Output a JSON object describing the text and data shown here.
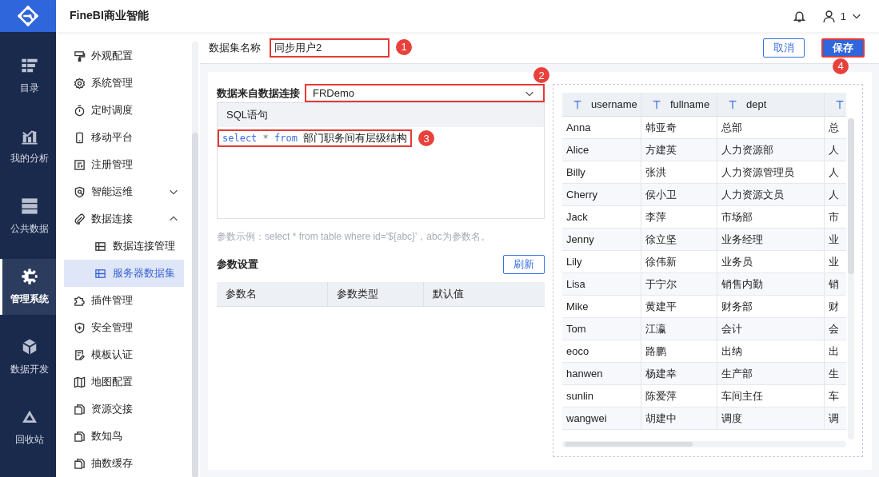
{
  "app": {
    "title": "FineBI商业智能",
    "user": "1"
  },
  "rail": [
    {
      "label": "目录",
      "kind": "catalog",
      "selected": false
    },
    {
      "label": "我的分析",
      "kind": "analysis",
      "selected": false
    },
    {
      "label": "公共数据",
      "kind": "public",
      "selected": false
    },
    {
      "label": "管理系统",
      "kind": "system",
      "selected": true
    },
    {
      "label": "数据开发",
      "kind": "dev",
      "selected": false
    },
    {
      "label": "回收站",
      "kind": "recycle",
      "selected": false
    }
  ],
  "menu": [
    {
      "label": "外观配置",
      "kind": "brush",
      "selected": false
    },
    {
      "label": "系统管理",
      "kind": "gear",
      "selected": false
    },
    {
      "label": "定时调度",
      "kind": "timer",
      "selected": false
    },
    {
      "label": "移动平台",
      "kind": "phone",
      "selected": false
    },
    {
      "label": "注册管理",
      "kind": "form",
      "selected": false
    },
    {
      "label": "智能运维",
      "kind": "shield",
      "selected": false,
      "expanded": false
    },
    {
      "label": "数据连接",
      "kind": "clip",
      "selected": false,
      "expanded": true,
      "children": [
        {
          "label": "数据连接管理",
          "kind": "table",
          "selected": false
        },
        {
          "label": "服务器数据集",
          "kind": "table",
          "selected": true
        }
      ]
    },
    {
      "label": "插件管理",
      "kind": "puzzle",
      "selected": false
    },
    {
      "label": "安全管理",
      "kind": "shieldplus",
      "selected": false
    },
    {
      "label": "模板认证",
      "kind": "doc",
      "selected": false
    },
    {
      "label": "地图配置",
      "kind": "map",
      "selected": false
    },
    {
      "label": "资源交接",
      "kind": "copy",
      "selected": false
    },
    {
      "label": "数知鸟",
      "kind": "copy",
      "selected": false
    },
    {
      "label": "抽数缓存",
      "kind": "copy",
      "selected": false
    }
  ],
  "dataset": {
    "label": "数据集名称",
    "value": "同步用户2",
    "callout": "1"
  },
  "buttons": [
    {
      "label": "取消",
      "kind": "secondary"
    },
    {
      "label": "保存",
      "kind": "primary",
      "callout": "4"
    }
  ],
  "connection": {
    "label": "数据来自数据连接",
    "value": "FRDemo",
    "callout": "2"
  },
  "sql": {
    "header": "SQL语句",
    "callout": "3",
    "tokens": [
      {
        "text": "select",
        "kind": "keyword"
      },
      {
        "text": "*",
        "kind": "operator"
      },
      {
        "text": "from",
        "kind": "keyword"
      },
      {
        "text": "部门职务间有层级结构",
        "kind": "identifier"
      }
    ]
  },
  "hint": "参数示例：select * from table where id='${abc}'，abc为参数名。",
  "params": {
    "title": "参数设置",
    "refresh": "刷新",
    "columns": [
      "参数名",
      "参数类型",
      "默认值"
    ]
  },
  "preview": {
    "columns": [
      {
        "name": "username",
        "kind": "text"
      },
      {
        "name": "fullname",
        "kind": "text"
      },
      {
        "name": "dept",
        "kind": "text"
      },
      {
        "kind": "text"
      }
    ],
    "rows": [
      [
        "Anna",
        "韩亚奇",
        "总部",
        "总"
      ],
      [
        "Alice",
        "方建英",
        "人力资源部",
        "人"
      ],
      [
        "Billy",
        "张洪",
        "人力资源管理员",
        "人"
      ],
      [
        "Cherry",
        "侯小卫",
        "人力资源文员",
        "人"
      ],
      [
        "Jack",
        "李萍",
        "市场部",
        "市"
      ],
      [
        "Jenny",
        "徐立坚",
        "业务经理",
        "业"
      ],
      [
        "Lily",
        "徐伟新",
        "业务员",
        "业"
      ],
      [
        "Lisa",
        "于宁尔",
        "销售内勤",
        "销"
      ],
      [
        "Mike",
        "黄建平",
        "财务部",
        "财"
      ],
      [
        "Tom",
        "江瀛",
        "会计",
        "会"
      ],
      [
        "eoco",
        "路鹏",
        "出纳",
        "出"
      ],
      [
        "hanwen",
        "杨建幸",
        "生产部",
        "生"
      ],
      [
        "sunlin",
        "陈爱萍",
        "车间主任",
        "车"
      ],
      [
        "wangwei",
        "胡建中",
        "调度",
        "调"
      ]
    ]
  }
}
